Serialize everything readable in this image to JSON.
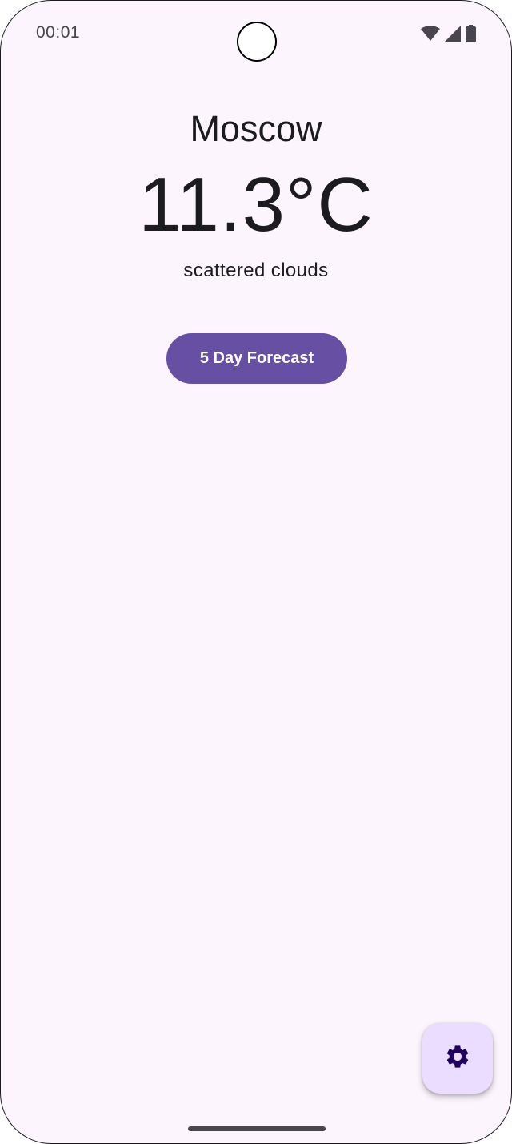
{
  "status_bar": {
    "time": "00:01",
    "icons": [
      "wifi-icon",
      "cellular-signal-icon",
      "battery-icon"
    ]
  },
  "weather": {
    "city": "Moscow",
    "temperature": "11.3°C",
    "description": "scattered clouds"
  },
  "actions": {
    "forecast_button_label": "5 Day Forecast",
    "settings_fab_icon": "gear-icon"
  },
  "colors": {
    "background": "#fcf5fd",
    "primary": "#6750a4",
    "fab_container": "#eaddff",
    "on_fab": "#21005d",
    "text": "#1c1b1f"
  }
}
